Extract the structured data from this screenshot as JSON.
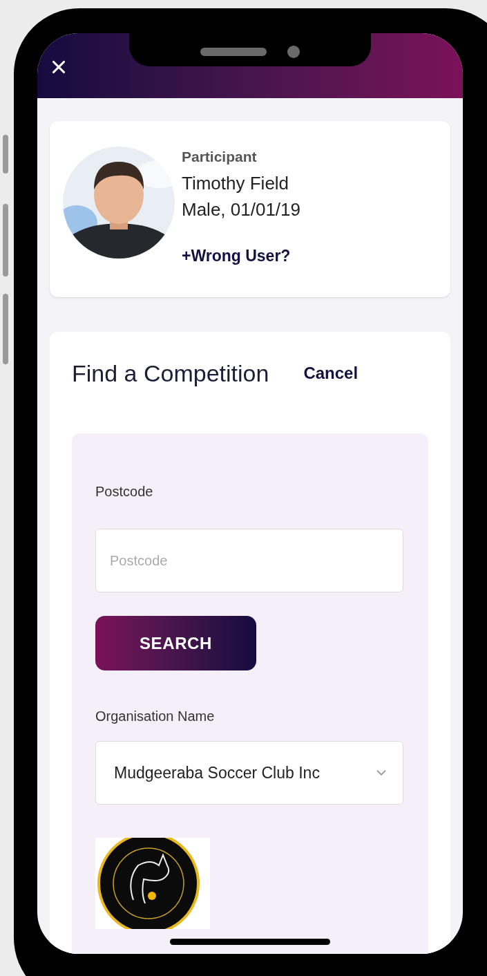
{
  "participant": {
    "role": "Participant",
    "name": "Timothy Field",
    "details": "Male, 01/01/19",
    "wrong_user_link": "+Wrong User?"
  },
  "competition": {
    "title": "Find a Competition",
    "cancel": "Cancel",
    "postcode": {
      "label": "Postcode",
      "placeholder": "Postcode"
    },
    "search_button": "SEARCH",
    "organisation": {
      "label": "Organisation Name",
      "value": "Mudgeeraba Soccer Club Inc"
    }
  }
}
